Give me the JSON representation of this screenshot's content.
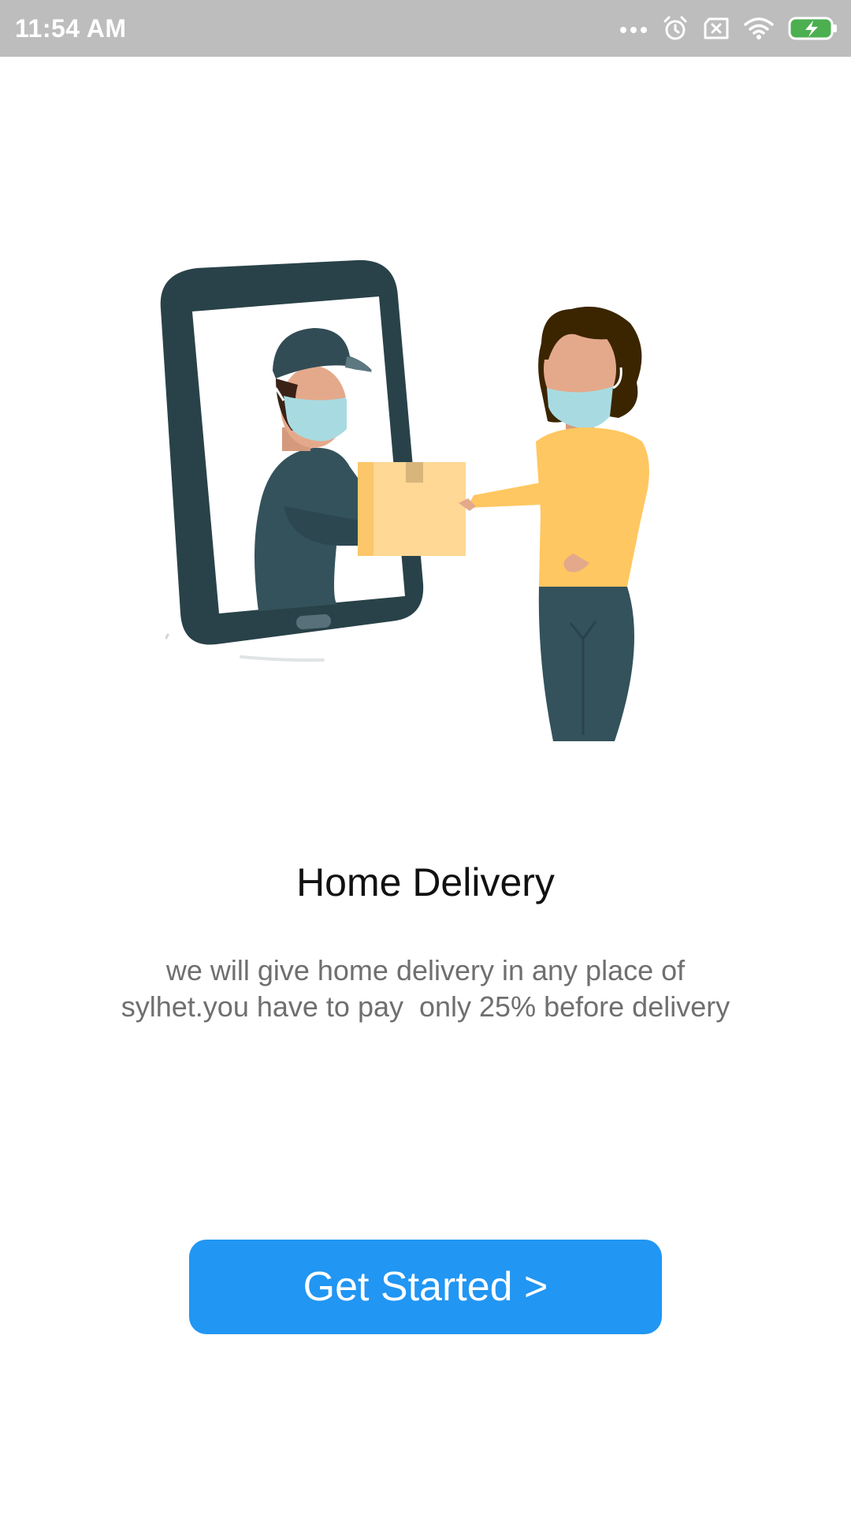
{
  "status_bar": {
    "time": "11:54 AM",
    "icons": [
      "more-dots-icon",
      "alarm-icon",
      "sim-x-icon",
      "wifi-icon",
      "battery-charging-icon"
    ]
  },
  "onboarding": {
    "illustration": "delivery-handover-illustration",
    "title": "Home Delivery",
    "description_line1": "we will give home delivery in any place of",
    "description_line2": "sylhet.you have to pay  only 25% before delivery",
    "button_label": "Get Started >"
  },
  "colors": {
    "status_bar": "#bdbdbd",
    "primary_button": "#2196f3",
    "title_text": "#111111",
    "description_text": "#6f6f6f",
    "battery": "#4caf50"
  }
}
